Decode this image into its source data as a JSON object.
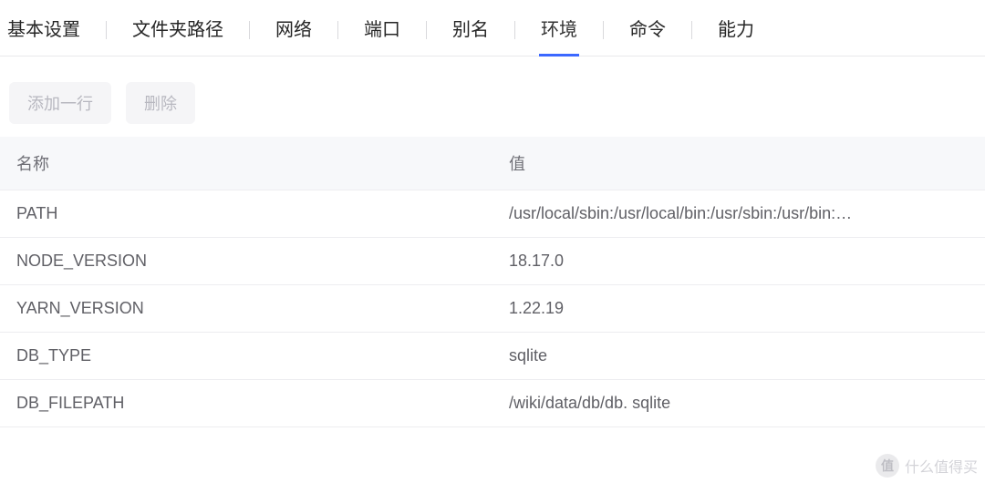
{
  "tabs": [
    {
      "id": "basic",
      "label": "基本设置",
      "active": false
    },
    {
      "id": "folder",
      "label": "文件夹路径",
      "active": false
    },
    {
      "id": "network",
      "label": "网络",
      "active": false
    },
    {
      "id": "port",
      "label": "端口",
      "active": false
    },
    {
      "id": "alias",
      "label": "别名",
      "active": false
    },
    {
      "id": "env",
      "label": "环境",
      "active": true
    },
    {
      "id": "command",
      "label": "命令",
      "active": false
    },
    {
      "id": "capability",
      "label": "能力",
      "active": false
    }
  ],
  "toolbar": {
    "add_label": "添加一行",
    "delete_label": "删除"
  },
  "table": {
    "columns": {
      "name": "名称",
      "value": "值"
    },
    "rows": [
      {
        "name": "PATH",
        "value": "/usr/local/sbin:/usr/local/bin:/usr/sbin:/usr/bin:…"
      },
      {
        "name": "NODE_VERSION",
        "value": "18.17.0"
      },
      {
        "name": "YARN_VERSION",
        "value": "1.22.19"
      },
      {
        "name": "DB_TYPE",
        "value": "sqlite"
      },
      {
        "name": "DB_FILEPATH",
        "value": "/wiki/data/db/db. sqlite"
      }
    ]
  },
  "watermark": {
    "badge": "值",
    "text": "什么值得买"
  }
}
